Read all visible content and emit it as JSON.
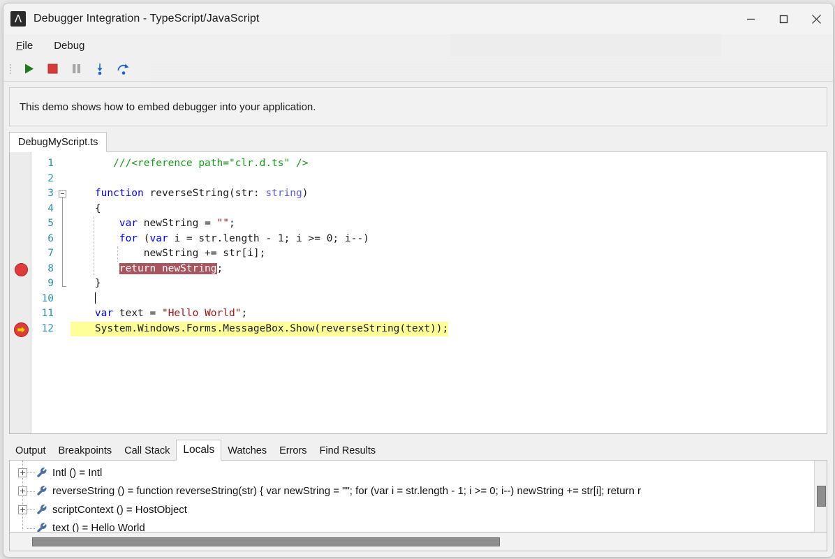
{
  "window": {
    "title": "Debugger Integration - TypeScript/JavaScript",
    "app_icon": "lambda-app-icon",
    "app_glyph": "Λ",
    "minimize_label": "Minimize",
    "maximize_label": "Maximize",
    "close_label": "Close"
  },
  "menubar": {
    "items": [
      {
        "mnemonic": "F",
        "rest": "ile",
        "name": "file"
      },
      {
        "mnemonic": "D",
        "rest": "ebug",
        "name": "debug",
        "no_underline": true
      }
    ]
  },
  "toolbar": {
    "buttons": [
      {
        "name": "run-button",
        "icon": "play-icon",
        "tooltip": "Run",
        "color": "#1f7a1f"
      },
      {
        "name": "stop-button",
        "icon": "stop-icon",
        "tooltip": "Stop",
        "color": "#d63b3b"
      },
      {
        "name": "pause-button",
        "icon": "pause-icon",
        "tooltip": "Pause",
        "color": "#a6a6a6"
      },
      {
        "name": "step-into-button",
        "icon": "step-into-icon",
        "tooltip": "Step Into",
        "color": "#1e64c8"
      },
      {
        "name": "step-over-button",
        "icon": "step-over-icon",
        "tooltip": "Step Over",
        "color": "#1e64c8"
      }
    ]
  },
  "banner": {
    "text": "This demo shows how to embed debugger into your application."
  },
  "file_tabs": [
    {
      "label": "DebugMyScript.ts",
      "active": true
    }
  ],
  "editor": {
    "line_numbers": [
      "1",
      "2",
      "3",
      "4",
      "5",
      "6",
      "7",
      "8",
      "9",
      "10",
      "11",
      "12"
    ],
    "breakpoint_line": 8,
    "current_statement_line": 12,
    "lines": [
      {
        "n": 1,
        "segments": [
          {
            "t": "       ",
            "c": ""
          },
          {
            "t": "///<reference path=\"clr.d.ts\" />",
            "c": "cmt"
          }
        ]
      },
      {
        "n": 2,
        "segments": [
          {
            "t": "",
            "c": ""
          }
        ]
      },
      {
        "n": 3,
        "segments": [
          {
            "t": "    ",
            "c": ""
          },
          {
            "t": "function",
            "c": "kw"
          },
          {
            "t": " reverseString(str: ",
            "c": ""
          },
          {
            "t": "string",
            "c": "typ"
          },
          {
            "t": ")",
            "c": ""
          }
        ]
      },
      {
        "n": 4,
        "segments": [
          {
            "t": "    {",
            "c": ""
          }
        ]
      },
      {
        "n": 5,
        "segments": [
          {
            "t": "        ",
            "c": ""
          },
          {
            "t": "var",
            "c": "kw"
          },
          {
            "t": " newString = ",
            "c": ""
          },
          {
            "t": "\"\"",
            "c": "str"
          },
          {
            "t": ";",
            "c": ""
          }
        ]
      },
      {
        "n": 6,
        "segments": [
          {
            "t": "        ",
            "c": ""
          },
          {
            "t": "for",
            "c": "kw"
          },
          {
            "t": " (",
            "c": ""
          },
          {
            "t": "var",
            "c": "kw"
          },
          {
            "t": " i = str.length - 1; i >= 0; i--)",
            "c": ""
          }
        ]
      },
      {
        "n": 7,
        "segments": [
          {
            "t": "            newString += str[i];",
            "c": ""
          }
        ]
      },
      {
        "n": 8,
        "segments": [
          {
            "t": "        ",
            "c": ""
          },
          {
            "t": "return newString",
            "c": "sel"
          },
          {
            "t": ";",
            "c": ""
          }
        ]
      },
      {
        "n": 9,
        "segments": [
          {
            "t": "    }",
            "c": ""
          }
        ]
      },
      {
        "n": 10,
        "segments": [
          {
            "t": "    ",
            "c": ""
          }
        ],
        "caret": true
      },
      {
        "n": 11,
        "segments": [
          {
            "t": "    ",
            "c": ""
          },
          {
            "t": "var",
            "c": "kw"
          },
          {
            "t": " text = ",
            "c": ""
          },
          {
            "t": "\"Hello World\"",
            "c": "str"
          },
          {
            "t": ";",
            "c": ""
          }
        ]
      },
      {
        "n": 12,
        "segments": [
          {
            "t": "    System.Windows.Forms.MessageBox.Show(reverseString(text));",
            "c": ""
          }
        ],
        "highlight": true
      }
    ]
  },
  "bottom_panel": {
    "tabs": [
      {
        "label": "Output",
        "active": false
      },
      {
        "label": "Breakpoints",
        "active": false
      },
      {
        "label": "Call Stack",
        "active": false
      },
      {
        "label": "Locals",
        "active": true
      },
      {
        "label": "Watches",
        "active": false
      },
      {
        "label": "Errors",
        "active": false
      },
      {
        "label": "Find Results",
        "active": false
      }
    ],
    "locals": [
      {
        "expandable": true,
        "icon": "wrench-icon",
        "text": "Intl () = Intl"
      },
      {
        "expandable": true,
        "icon": "wrench-icon",
        "text": "reverseString () = function reverseString(str) {    var newString = \"\";   for (var i = str.length - 1; i >= 0; i--)       newString += str[i];   return r"
      },
      {
        "expandable": true,
        "icon": "wrench-icon",
        "text": "scriptContext () = HostObject"
      },
      {
        "expandable": false,
        "icon": "wrench-icon",
        "text": "text () = Hello World"
      }
    ]
  },
  "colors": {
    "keyword": "#0000ff",
    "type": "#5a5ae0",
    "string": "#a31515",
    "comment": "#159b15",
    "selection": "#a8555f",
    "current_line": "#ffff99",
    "line_number": "#2b91af",
    "breakpoint": "#e03b3b",
    "current_arrow": "#f5c518"
  }
}
